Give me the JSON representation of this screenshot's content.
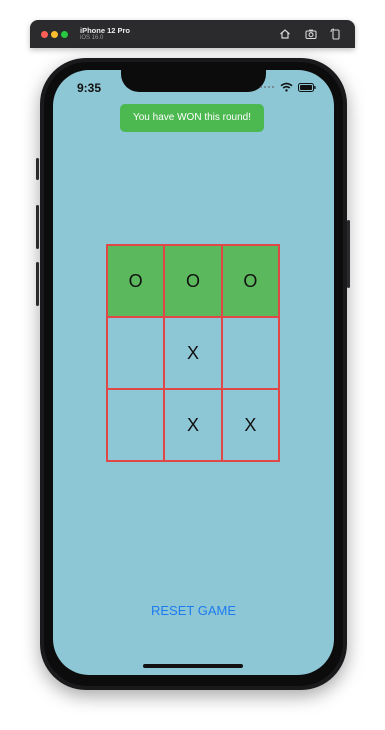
{
  "simulator": {
    "device_name": "iPhone 12 Pro",
    "os_version": "iOS 16.0"
  },
  "status_bar": {
    "time": "9:35"
  },
  "toast": {
    "message": "You have WON this round!"
  },
  "board": {
    "cells": [
      "O",
      "O",
      "O",
      "",
      "X",
      "",
      "",
      "X",
      "X"
    ],
    "winning_cells": [
      0,
      1,
      2
    ]
  },
  "actions": {
    "reset_label": "RESET GAME"
  },
  "colors": {
    "screen_background": "#8dc6d4",
    "win_highlight": "#5cb85c",
    "grid_line": "#e04848",
    "toast_background": "#4cb850",
    "reset_link": "#1e7cf0"
  }
}
